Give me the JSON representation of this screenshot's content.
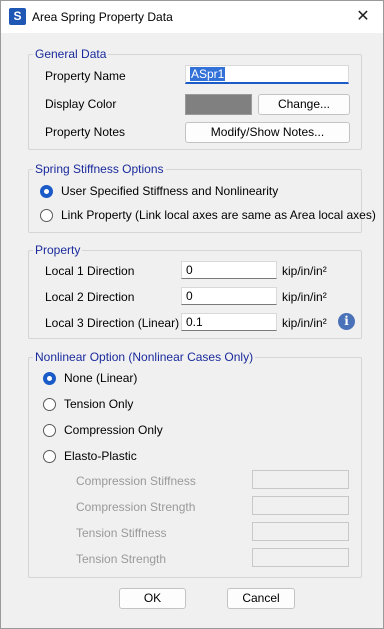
{
  "window": {
    "title": "Area Spring Property Data",
    "app_icon_letter": "S",
    "close_glyph": "✕"
  },
  "general": {
    "legend": "General Data",
    "property_name_label": "Property Name",
    "property_name_value": "ASpr1",
    "display_color_label": "Display Color",
    "display_color": "#808080",
    "change_button": "Change...",
    "property_notes_label": "Property Notes",
    "notes_button": "Modify/Show Notes..."
  },
  "stiffness": {
    "legend": "Spring Stiffness Options",
    "options": [
      {
        "label": "User Specified Stiffness and Nonlinearity",
        "checked": true
      },
      {
        "label": "Link Property (Link local axes are same as Area local axes)",
        "checked": false
      }
    ]
  },
  "property": {
    "legend": "Property",
    "rows": [
      {
        "label": "Local 1 Direction",
        "value": "0",
        "unit": "kip/in/in²"
      },
      {
        "label": "Local 2 Direction",
        "value": "0",
        "unit": "kip/in/in²"
      },
      {
        "label": "Local 3 Direction (Linear)",
        "value": "0.1",
        "unit": "kip/in/in²"
      }
    ],
    "info_glyph": "i"
  },
  "nonlinear": {
    "legend": "Nonlinear Option (Nonlinear Cases Only)",
    "options": [
      {
        "label": "None (Linear)",
        "checked": true
      },
      {
        "label": "Tension Only",
        "checked": false
      },
      {
        "label": "Compression Only",
        "checked": false
      },
      {
        "label": "Elasto-Plastic",
        "checked": false
      }
    ],
    "elasto_fields": [
      {
        "label": "Compression Stiffness",
        "value": ""
      },
      {
        "label": "Compression Strength",
        "value": ""
      },
      {
        "label": "Tension Stiffness",
        "value": ""
      },
      {
        "label": "Tension Strength",
        "value": ""
      }
    ]
  },
  "footer": {
    "ok": "OK",
    "cancel": "Cancel"
  }
}
